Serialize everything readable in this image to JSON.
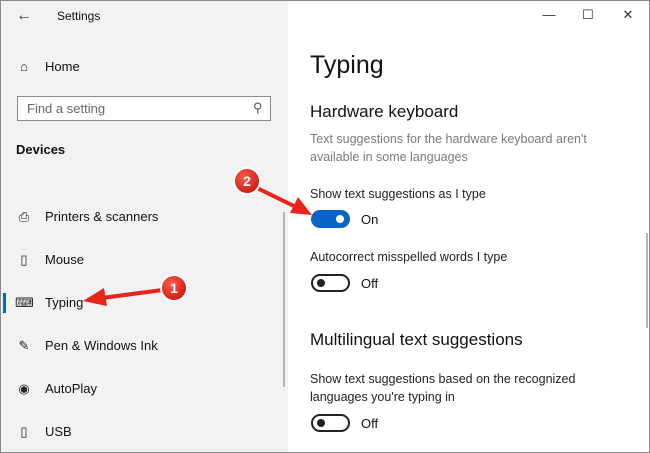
{
  "window": {
    "title": "Settings",
    "back_glyph": "←",
    "minimize_glyph": "—",
    "maximize_glyph": "☐",
    "close_glyph": "✕"
  },
  "sidebar": {
    "home": {
      "label": "Home",
      "icon": "home-icon",
      "glyph": "⌂"
    },
    "search": {
      "placeholder": "Find a setting",
      "icon": "search-icon",
      "glyph": "⚲"
    },
    "section": "Devices",
    "items": [
      {
        "label": "Printers & scanners",
        "icon": "printer-icon",
        "glyph": "⎙"
      },
      {
        "label": "Mouse",
        "icon": "mouse-icon",
        "glyph": "▯"
      },
      {
        "label": "Typing",
        "icon": "keyboard-icon",
        "glyph": "⌨",
        "active": true
      },
      {
        "label": "Pen & Windows Ink",
        "icon": "pen-icon",
        "glyph": "✎"
      },
      {
        "label": "AutoPlay",
        "icon": "autoplay-icon",
        "glyph": "◉"
      },
      {
        "label": "USB",
        "icon": "usb-icon",
        "glyph": "▯"
      }
    ]
  },
  "main": {
    "title": "Typing",
    "hardware": {
      "heading": "Hardware keyboard",
      "note": "Text suggestions for the hardware keyboard aren't available in some languages",
      "show_suggestions": {
        "label": "Show text suggestions as I type",
        "state": "On"
      },
      "autocorrect": {
        "label": "Autocorrect misspelled words I type",
        "state": "Off"
      }
    },
    "multilingual": {
      "heading": "Multilingual text suggestions",
      "label": "Show text suggestions based on the recognized languages you're typing in",
      "state": "Off"
    }
  },
  "annotations": {
    "badge_1": "1",
    "badge_2": "2",
    "color": "#e8241c"
  },
  "colors": {
    "accent": "#0a64c8",
    "sidebar_bg": "#f2f2f2"
  }
}
